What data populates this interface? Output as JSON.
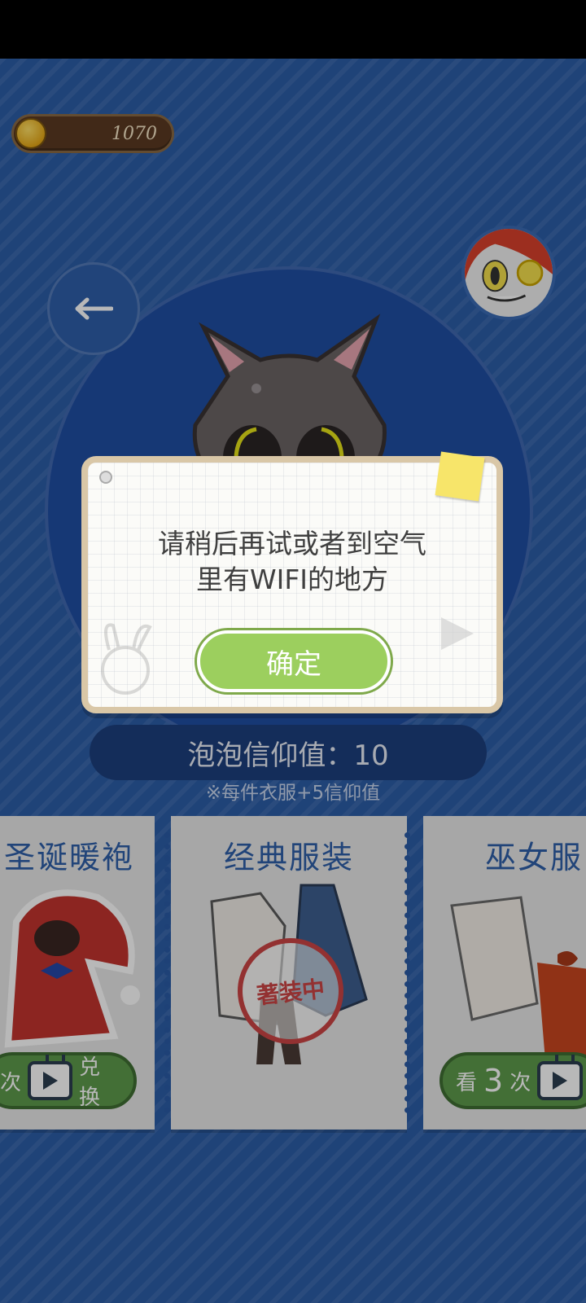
{
  "header": {
    "coins": "1070"
  },
  "faith": {
    "label": "泡泡信仰值：10",
    "note": "※每件衣服+5信仰值"
  },
  "cards": [
    {
      "title": "圣诞暖袍",
      "button_prefix": "次",
      "button_suffix": "兑换"
    },
    {
      "title": "经典服装",
      "stamp": "著装中"
    },
    {
      "title": "巫女服",
      "button_prefix": "看",
      "button_count": "3",
      "button_mid": "次"
    }
  ],
  "dialog": {
    "message_line1": "请稍后再试或者到空气",
    "message_line2": "里有WIFI的地方",
    "ok_label": "确定"
  },
  "colors": {
    "background": "#2c5ea7",
    "accent_green": "#9ccf5e",
    "title_blue": "#2f5fa8"
  }
}
